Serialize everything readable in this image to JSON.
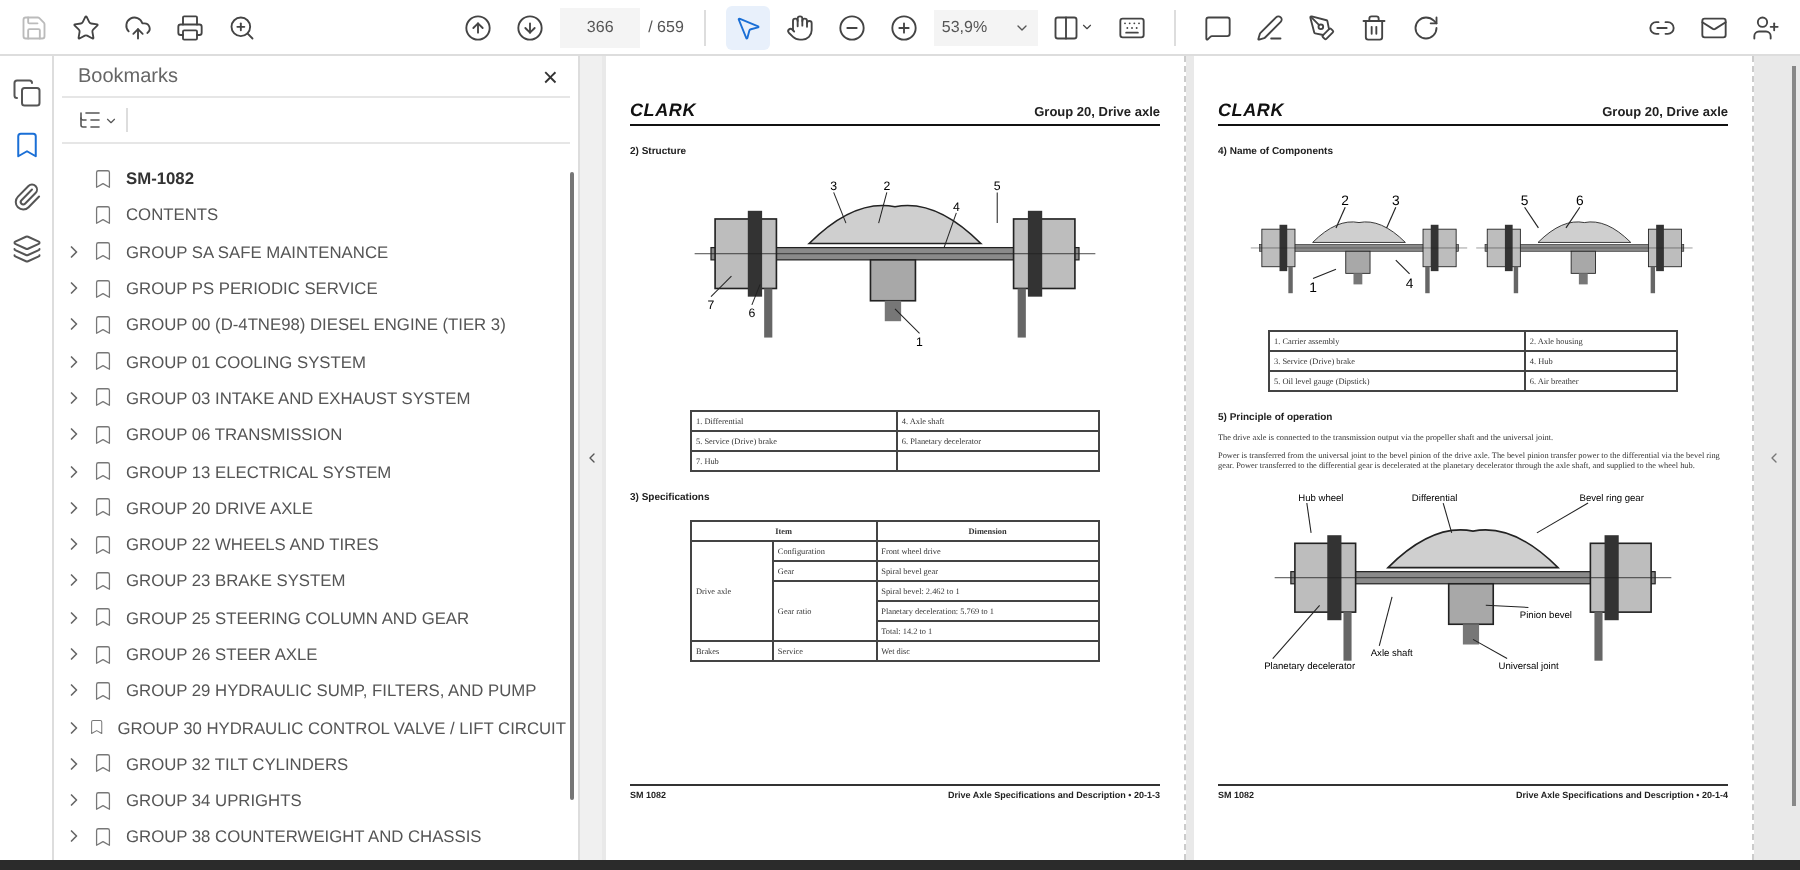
{
  "toolbar": {
    "page_number": "366",
    "page_total": "/ 659",
    "zoom": "53,9%",
    "tools": [
      {
        "kind": "select",
        "selected": true
      },
      {
        "kind": "hand",
        "selected": false
      }
    ]
  },
  "rail": [
    {
      "kind": "pages",
      "selected": false
    },
    {
      "kind": "bookmarks",
      "selected": true
    },
    {
      "kind": "attachments",
      "selected": false
    },
    {
      "kind": "layers",
      "selected": false
    }
  ],
  "bookmarks": {
    "title": "Bookmarks",
    "close": "×",
    "items": [
      {
        "label": "SM-1082",
        "expandable": false,
        "bold": true
      },
      {
        "label": "CONTENTS",
        "expandable": false,
        "bold": false
      },
      {
        "label": "GROUP SA SAFE MAINTENANCE",
        "expandable": true,
        "bold": false
      },
      {
        "label": "GROUP PS PERIODIC SERVICE",
        "expandable": true,
        "bold": false
      },
      {
        "label": "GROUP 00 (D-4TNE98) DIESEL ENGINE (TIER 3)",
        "expandable": true,
        "bold": false
      },
      {
        "label": "GROUP 01 COOLING SYSTEM",
        "expandable": true,
        "bold": false
      },
      {
        "label": "GROUP 03 INTAKE AND EXHAUST SYSTEM",
        "expandable": true,
        "bold": false
      },
      {
        "label": "GROUP 06 TRANSMISSION",
        "expandable": true,
        "bold": false
      },
      {
        "label": "GROUP 13 ELECTRICAL SYSTEM",
        "expandable": true,
        "bold": false
      },
      {
        "label": "GROUP 20 DRIVE AXLE",
        "expandable": true,
        "bold": false
      },
      {
        "label": "GROUP 22 WHEELS AND TIRES",
        "expandable": true,
        "bold": false
      },
      {
        "label": "GROUP 23 BRAKE SYSTEM",
        "expandable": true,
        "bold": false
      },
      {
        "label": "GROUP 25 STEERING COLUMN AND GEAR",
        "expandable": true,
        "bold": false
      },
      {
        "label": "GROUP 26 STEER AXLE",
        "expandable": true,
        "bold": false
      },
      {
        "label": "GROUP 29 HYDRAULIC SUMP, FILTERS, AND PUMP",
        "expandable": true,
        "bold": false
      },
      {
        "label": "GROUP 30 HYDRAULIC CONTROL VALVE / LIFT CIRCUIT",
        "expandable": true,
        "bold": false
      },
      {
        "label": "GROUP 32 TILT CYLINDERS",
        "expandable": true,
        "bold": false
      },
      {
        "label": "GROUP 34 UPRIGHTS",
        "expandable": true,
        "bold": false
      },
      {
        "label": "GROUP 38 COUNTERWEIGHT AND CHASSIS",
        "expandable": true,
        "bold": false
      }
    ]
  },
  "pages": [
    {
      "logo": "CLARK",
      "header": "Group 20, Drive axle",
      "sections": [
        {
          "kind": "diagram",
          "heading": "2) Structure",
          "callouts": [
            "3",
            "2",
            "5",
            "4",
            "7",
            "6",
            "1"
          ]
        },
        {
          "kind": "parts",
          "rows": [
            [
              "1. Differential",
              "4. Axle shaft"
            ],
            [
              "5. Service (Drive) brake",
              "6. Planetary decelerator"
            ],
            [
              "7. Hub",
              ""
            ]
          ]
        },
        {
          "kind": "specs",
          "heading": "3) Specifications",
          "columns": [
            "Item",
            "Dimension"
          ],
          "groups": [
            {
              "name": "Drive axle",
              "items": [
                {
                  "name": "Configuration",
                  "values": [
                    "Front wheel drive"
                  ]
                },
                {
                  "name": "Gear",
                  "values": [
                    "Spiral bevel gear"
                  ]
                },
                {
                  "name": "Gear ratio",
                  "values": [
                    "Spiral bevel: 2.462 to 1",
                    "Planetary deceleration: 5.769 to 1",
                    "Total: 14.2 to 1"
                  ]
                }
              ]
            },
            {
              "name": "Brakes",
              "items": [
                {
                  "name": "Service",
                  "values": [
                    "Wet disc"
                  ]
                }
              ]
            }
          ]
        }
      ],
      "footer_left": "SM 1082",
      "footer_right": "Drive Axle Specifications and Description • 20-1-3"
    },
    {
      "logo": "CLARK",
      "header": "Group 20, Drive axle",
      "sections": [
        {
          "kind": "twin",
          "heading": "4) Name of Components",
          "callouts": [
            "2",
            "3",
            "5",
            "6",
            "1",
            "4"
          ]
        },
        {
          "kind": "parts",
          "rows": [
            [
              "1. Carrier assembly",
              "2. Axle housing"
            ],
            [
              "3. Service (Drive) brake",
              "4. Hub"
            ],
            [
              "5. Oil level gauge (Dipstick)",
              "6. Air breather"
            ]
          ]
        },
        {
          "kind": "text",
          "heading": "5) Principle of operation",
          "paragraphs": [
            "The drive axle is connected to the transmission output via the propeller shaft and the universal joint.",
            "Power is transferred from the universal joint to the bevel pinion of the drive axle. The bevel pinion transfer power to the differential via the bevel ring gear. Power transferred to the differential gear is decelerated at the planetary decelerator through the axle shaft, and supplied to the wheel hub."
          ]
        },
        {
          "kind": "labeled",
          "labels": [
            "Hub wheel",
            "Differential",
            "Bevel ring gear",
            "Planetary decelerator",
            "Axle shaft",
            "Pinion bevel",
            "Universal joint"
          ]
        }
      ],
      "footer_left": "SM 1082",
      "footer_right": "Drive Axle Specifications and Description • 20-1-4"
    }
  ]
}
